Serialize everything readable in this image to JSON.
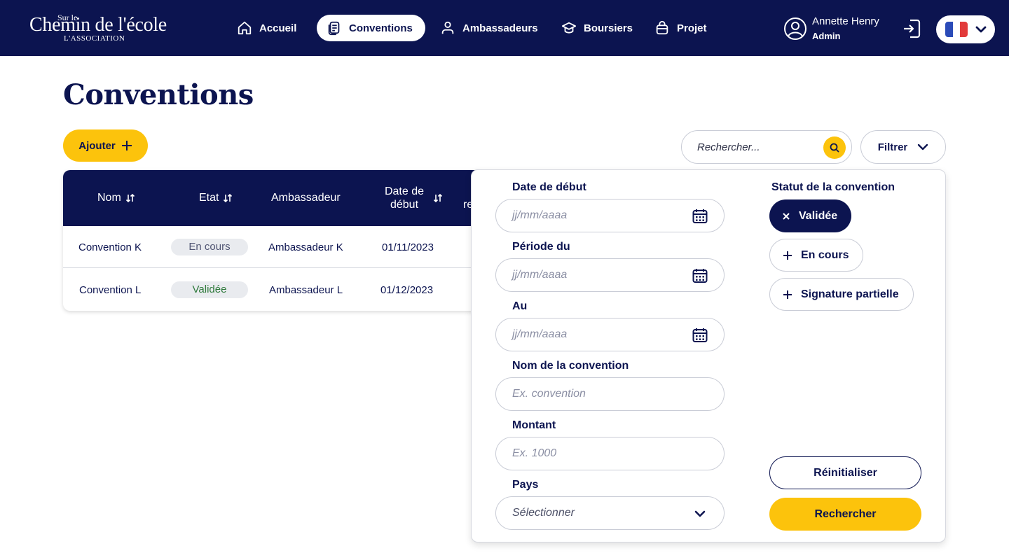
{
  "header": {
    "logo": {
      "top": "Sur le",
      "main": "Chemin de l'école",
      "sub": "L'ASSOCIATION"
    },
    "nav": [
      {
        "label": "Accueil",
        "icon": "home-icon"
      },
      {
        "label": "Conventions",
        "icon": "document-icon",
        "active": true
      },
      {
        "label": "Ambassadeurs",
        "icon": "person-icon"
      },
      {
        "label": "Boursiers",
        "icon": "graduation-cap-icon"
      },
      {
        "label": "Projet",
        "icon": "bag-icon"
      }
    ],
    "user": {
      "name": "Annette Henry",
      "role": "Admin"
    },
    "language": {
      "flag": "fr",
      "colors": [
        "#2b4bb8",
        "#ffffff",
        "#e23b3b"
      ]
    }
  },
  "page": {
    "title": "Conventions",
    "add_label": "Ajouter",
    "search_placeholder": "Rechercher...",
    "filter_label": "Filtrer"
  },
  "table": {
    "columns": [
      "Nom",
      "Etat",
      "Ambassadeur",
      "Date de début",
      "re"
    ],
    "rows": [
      {
        "nom": "Convention K",
        "etat": "En cours",
        "ambassadeur": "Ambassadeur K",
        "date": "01/11/2023"
      },
      {
        "nom": "Convention L",
        "etat": "Validée",
        "ambassadeur": "Ambassadeur L",
        "date": "01/12/2023"
      }
    ]
  },
  "filters": {
    "start_date": {
      "label": "Date de début",
      "placeholder": "jj/mm/aaaa"
    },
    "period_from": {
      "label": "Période du",
      "placeholder": "jj/mm/aaaa"
    },
    "period_to": {
      "label": "Au",
      "placeholder": "jj/mm/aaaa"
    },
    "name": {
      "label": "Nom de la convention",
      "placeholder": "Ex. convention"
    },
    "amount": {
      "label": "Montant",
      "placeholder": "Ex. 1000"
    },
    "country": {
      "label": "Pays",
      "placeholder": "Sélectionner"
    },
    "status": {
      "label": "Statut de la convention",
      "options": [
        {
          "label": "Validée",
          "selected": true
        },
        {
          "label": "En cours",
          "selected": false
        },
        {
          "label": "Signature partielle",
          "selected": false
        }
      ]
    },
    "reset_label": "Réinitialiser",
    "search_label": "Rechercher"
  },
  "colors": {
    "navy": "#0c1450",
    "accent": "#fcc30c"
  }
}
